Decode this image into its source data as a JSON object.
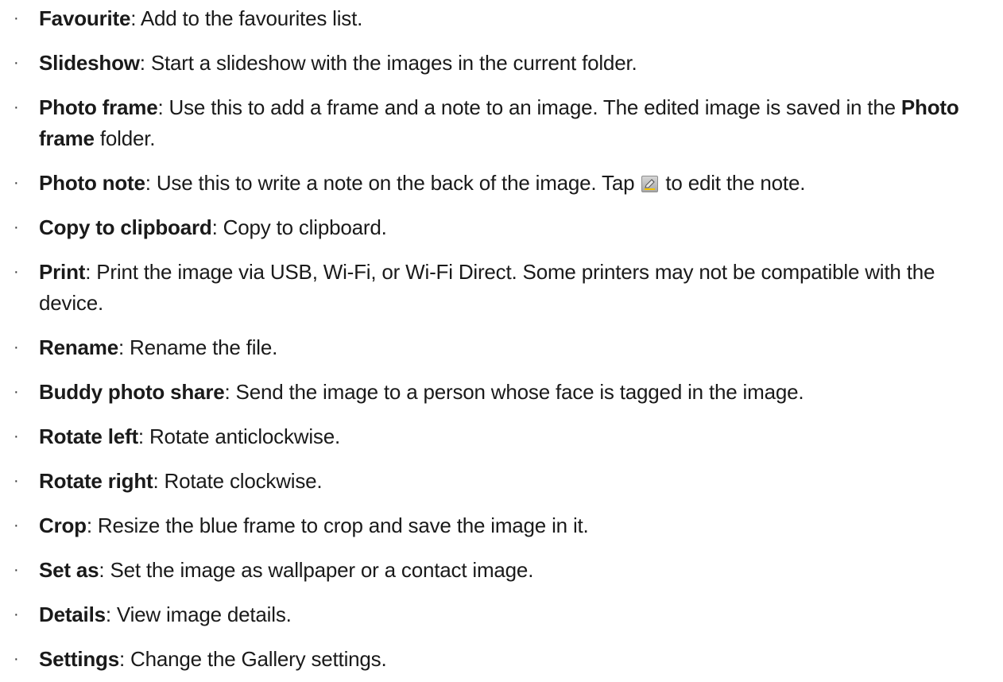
{
  "bullet_glyph": "·",
  "items": [
    {
      "term": "Favourite",
      "desc": ": Add to the favourites list."
    },
    {
      "term": "Slideshow",
      "desc": ": Start a slideshow with the images in the current folder."
    },
    {
      "term": "Photo frame",
      "desc_a": ": Use this to add a frame and a note to an image. The edited image is saved in the ",
      "desc_bold": "Photo frame",
      "desc_b": " folder."
    },
    {
      "term": "Photo note",
      "desc_a": ": Use this to write a note on the back of the image. Tap ",
      "icon": "edit-pencil-icon",
      "desc_b": " to edit the note."
    },
    {
      "term": "Copy to clipboard",
      "desc": ": Copy to clipboard."
    },
    {
      "term": "Print",
      "desc": ": Print the image via USB, Wi-Fi, or Wi-Fi Direct. Some printers may not be compatible with the device."
    },
    {
      "term": "Rename",
      "desc": ": Rename the file."
    },
    {
      "term": "Buddy photo share",
      "desc": ": Send the image to a person whose face is tagged in the image."
    },
    {
      "term": "Rotate left",
      "desc": ": Rotate anticlockwise."
    },
    {
      "term": "Rotate right",
      "desc": ": Rotate clockwise."
    },
    {
      "term": "Crop",
      "desc": ": Resize the blue frame to crop and save the image in it."
    },
    {
      "term": "Set as",
      "desc": ": Set the image as wallpaper or a contact image."
    },
    {
      "term": "Details",
      "desc": ": View image details."
    },
    {
      "term": "Settings",
      "desc": ": Change the Gallery settings."
    }
  ]
}
